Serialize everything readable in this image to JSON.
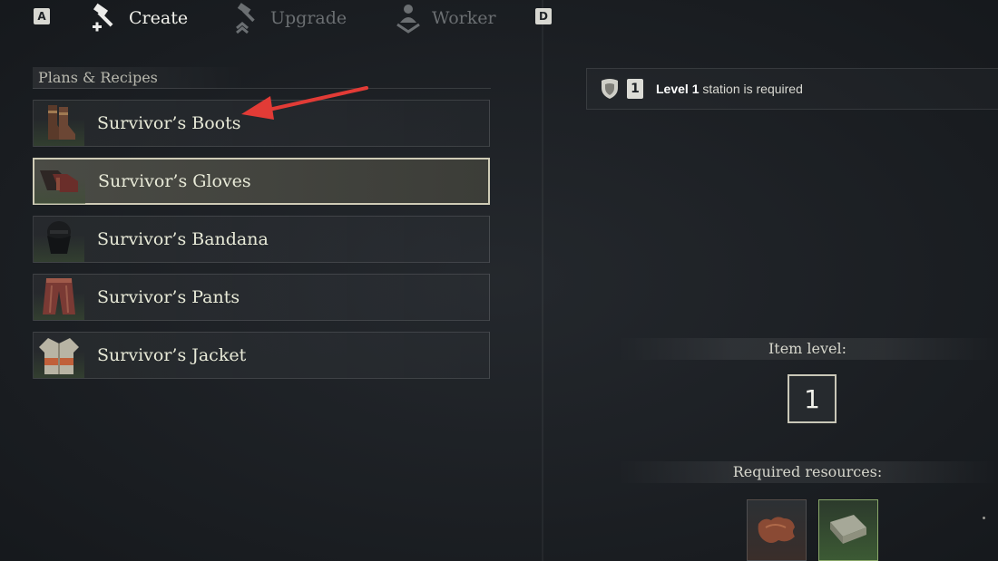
{
  "tabs": {
    "left_key": "A",
    "right_key": "D",
    "items": [
      {
        "label": "Create",
        "icon": "hammer-plus-icon",
        "active": true
      },
      {
        "label": "Upgrade",
        "icon": "hammer-upgrade-icon",
        "active": false
      },
      {
        "label": "Worker",
        "icon": "worker-icon",
        "active": false
      }
    ]
  },
  "plans": {
    "title": "Plans & Recipes",
    "items": [
      {
        "name": "Survivor’s Boots",
        "icon": "boots-icon",
        "selected": false
      },
      {
        "name": "Survivor’s Gloves",
        "icon": "gloves-icon",
        "selected": true
      },
      {
        "name": "Survivor’s Bandana",
        "icon": "bandana-icon",
        "selected": false
      },
      {
        "name": "Survivor’s Pants",
        "icon": "pants-icon",
        "selected": false
      },
      {
        "name": "Survivor’s Jacket",
        "icon": "jacket-icon",
        "selected": false
      }
    ]
  },
  "station": {
    "level_badge": "1",
    "level_label": "Level 1",
    "suffix": " station is required"
  },
  "item_level": {
    "label": "Item level:",
    "value": "1"
  },
  "resources": {
    "label": "Required resources:",
    "items": [
      {
        "icon": "hide-leather-icon"
      },
      {
        "icon": "linen-cloth-icon"
      }
    ]
  },
  "colors": {
    "background": "#1d2126",
    "selected_border": "#cfcbb6",
    "annotation_arrow": "#e23b36"
  }
}
